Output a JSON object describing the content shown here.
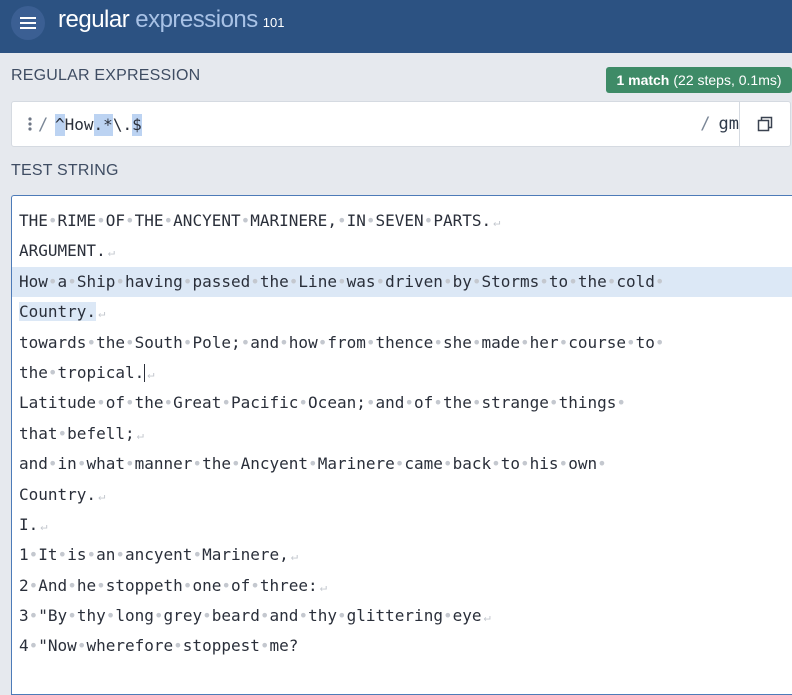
{
  "header": {
    "brand_regular": "regular",
    "brand_expressions": "expressions",
    "brand_number": "101"
  },
  "regex_section": {
    "label": "REGULAR EXPRESSION",
    "match_count": "1 match",
    "match_detail": "(22 steps, 0.1ms)",
    "delimiter_left": "/",
    "delimiter_right": "/",
    "flags": "gm",
    "pattern_tokens": [
      {
        "text": "^",
        "highlight": true
      },
      {
        "text": "How",
        "highlight": false
      },
      {
        "text": ".*",
        "highlight": true
      },
      {
        "text": "\\.",
        "highlight": false
      },
      {
        "text": "$",
        "highlight": true
      }
    ]
  },
  "test_section": {
    "label": "TEST STRING",
    "lines": [
      {
        "text": "THE RIME OF THE ANCYENT MARINERE, IN SEVEN PARTS.",
        "newline": true,
        "match": false
      },
      {
        "text": "ARGUMENT.",
        "newline": true,
        "match": false
      },
      {
        "text": "How a Ship having passed the Line was driven by Storms to the cold ",
        "newline": false,
        "match": true
      },
      {
        "text": "Country.",
        "newline": true,
        "match": true,
        "partial": true
      },
      {
        "text": "towards the South Pole; and how from thence she made her course to ",
        "newline": false,
        "match": false
      },
      {
        "text": "the tropical.",
        "newline": true,
        "match": false,
        "caret": true
      },
      {
        "text": "Latitude of the Great Pacific Ocean; and of the strange things ",
        "newline": false,
        "match": false
      },
      {
        "text": "that befell;",
        "newline": true,
        "match": false
      },
      {
        "text": "and in what manner the Ancyent Marinere came back to his own ",
        "newline": false,
        "match": false
      },
      {
        "text": "Country.",
        "newline": true,
        "match": false
      },
      {
        "text": "I.",
        "newline": true,
        "match": false
      },
      {
        "text": "1 It is an ancyent Marinere,",
        "newline": true,
        "match": false
      },
      {
        "text": "2 And he stoppeth one of three:",
        "newline": true,
        "match": false
      },
      {
        "text": "3 \"By thy long grey beard and thy glittering eye",
        "newline": true,
        "match": false
      },
      {
        "text": "4 \"Now wherefore stoppest me?",
        "newline": false,
        "match": false
      }
    ]
  }
}
